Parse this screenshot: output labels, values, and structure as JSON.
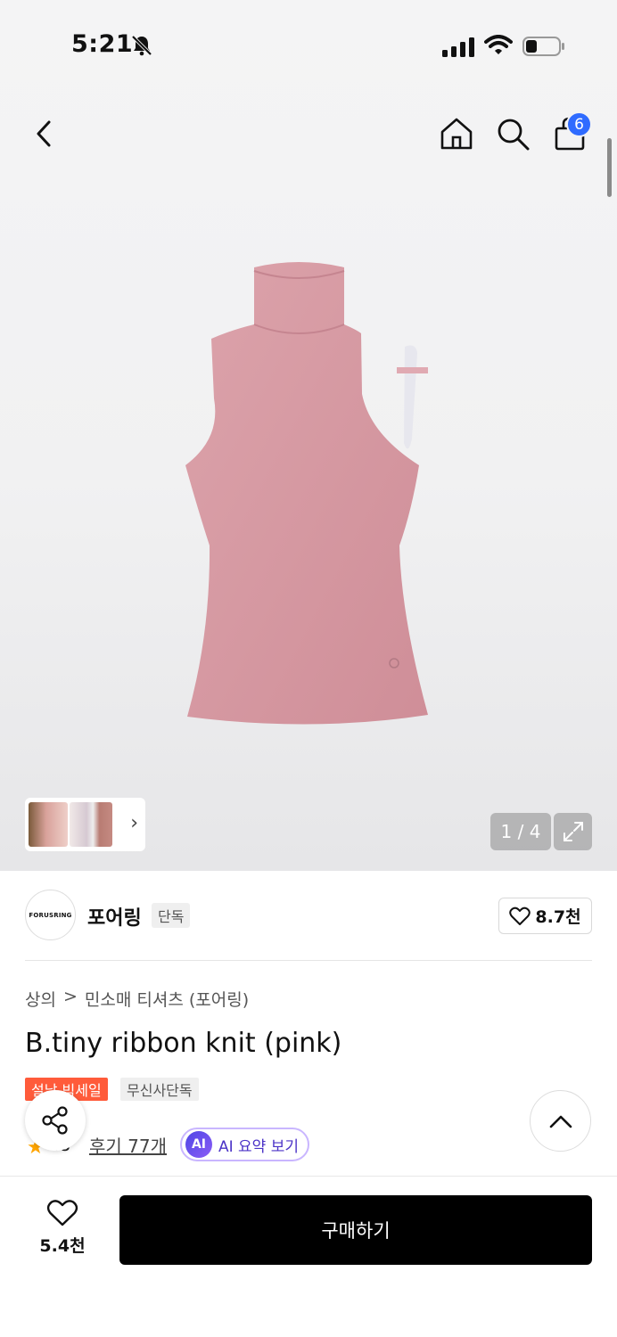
{
  "status_bar": {
    "time": "5:21"
  },
  "header": {
    "cart_badge": "6"
  },
  "gallery": {
    "counter": "1 / 4",
    "product_color": "#d99aa2"
  },
  "brand": {
    "logo_text": "FORUSRING",
    "name": "포어링",
    "tag": "단독",
    "likes": "8.7천"
  },
  "breadcrumb": {
    "category": "상의",
    "separator": ">",
    "subcategory": "민소매 티셔츠 (포어링)"
  },
  "product": {
    "title": "B.tiny ribbon knit (pink)",
    "tags": [
      "설날 빅세일",
      "무신사단독"
    ],
    "rating": ".8",
    "reviews": "후기 77개",
    "ai_badge": "AI",
    "ai_label": "AI 요약 보기"
  },
  "bottom": {
    "wish_count": "5.4천",
    "buy_label": "구매하기"
  },
  "colors": {
    "accent_blue": "#2f6bff",
    "sale_red": "#ff5b3a",
    "buy_bg": "#000000"
  }
}
